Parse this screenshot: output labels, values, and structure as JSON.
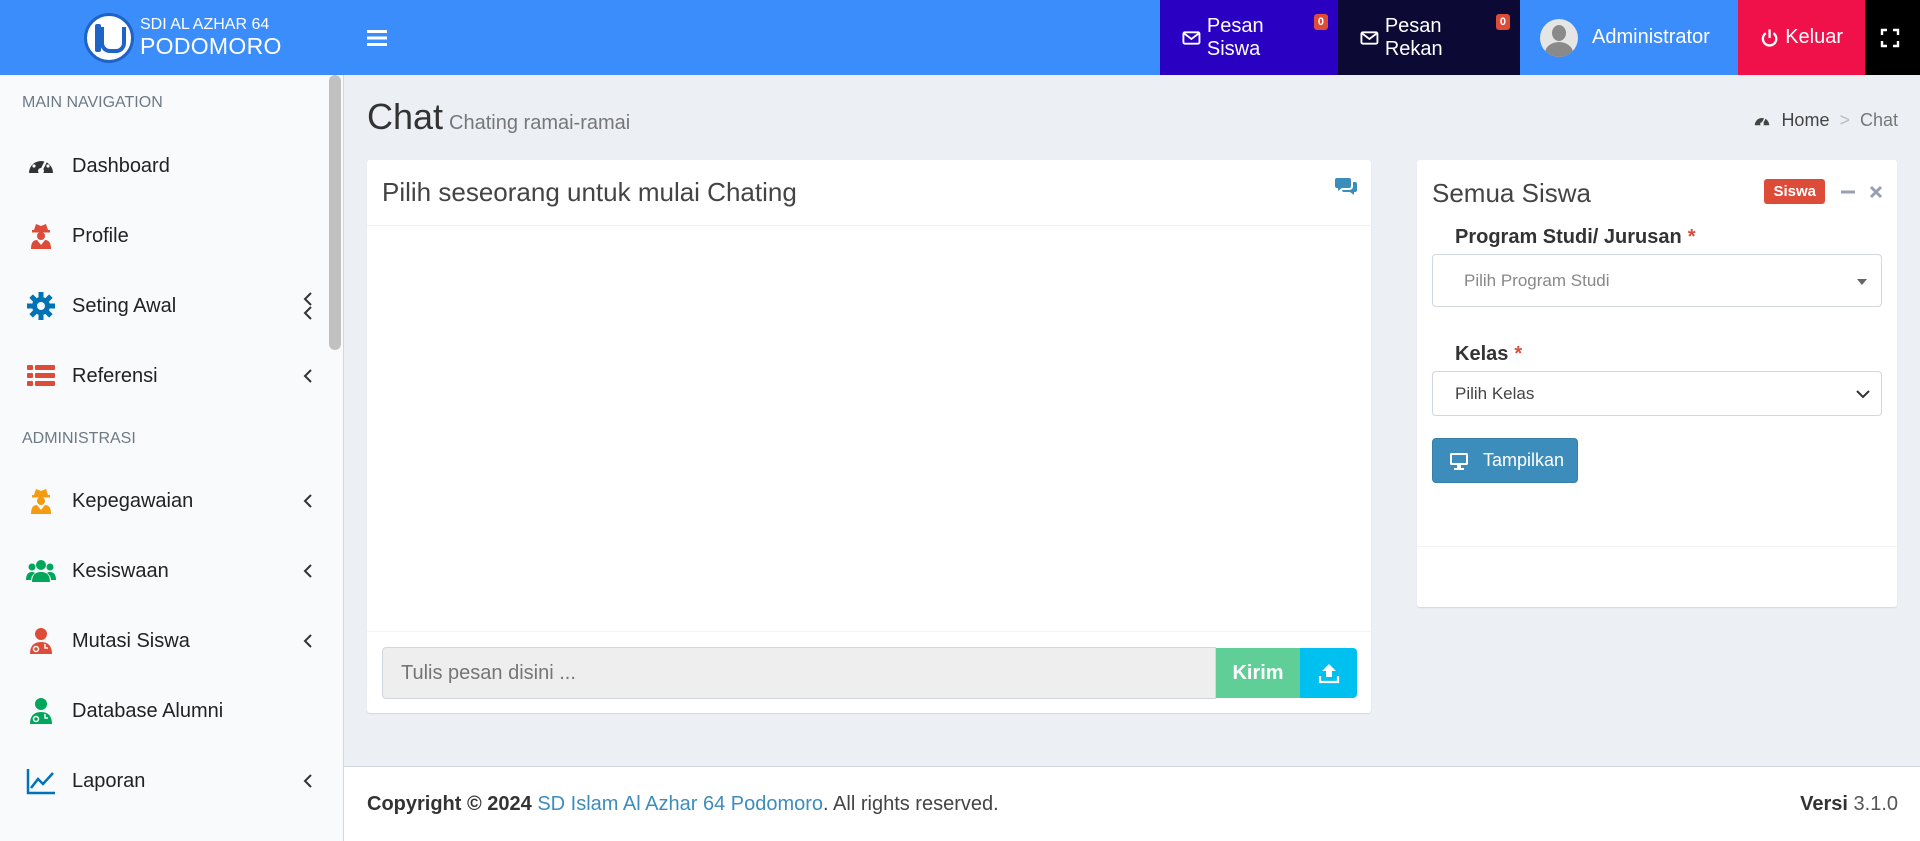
{
  "header": {
    "logo_small": "SDI AL AZHAR 64",
    "logo_big": "PODOMORO",
    "pesan_siswa": "Pesan Siswa",
    "pesan_siswa_count": "0",
    "pesan_rekan": "Pesan Rekan",
    "pesan_rekan_count": "0",
    "user_name": "Administrator",
    "logout": "Keluar"
  },
  "sidebar": {
    "header_main": "MAIN NAVIGATION",
    "header_admin": "ADMINISTRASI",
    "items": [
      {
        "label": "Dashboard",
        "icon": "dashboard-icon",
        "color": "#333333"
      },
      {
        "label": "Profile",
        "icon": "user-secret-icon",
        "color": "#dd4b39"
      },
      {
        "label": "Seting Awal",
        "icon": "gear-icon",
        "color": "#0073b7"
      },
      {
        "label": "Referensi",
        "icon": "list-icon",
        "color": "#dd4b39"
      },
      {
        "label": "Kepegawaian",
        "icon": "user-secret-icon",
        "color": "#f39c12"
      },
      {
        "label": "Kesiswaan",
        "icon": "users-icon",
        "color": "#00a65a"
      },
      {
        "label": "Mutasi Siswa",
        "icon": "user-md-icon",
        "color": "#dd4b39"
      },
      {
        "label": "Database Alumni",
        "icon": "user-md-icon",
        "color": "#00a65a"
      },
      {
        "label": "Laporan",
        "icon": "line-chart-icon",
        "color": "#0073b7"
      }
    ]
  },
  "page": {
    "title": "Chat",
    "subtitle": "Chating ramai-ramai",
    "breadcrumb_home": "Home",
    "breadcrumb_current": "Chat"
  },
  "chat": {
    "title": "Pilih seseorang untuk mulai Chating",
    "input_placeholder": "Tulis pesan disini ...",
    "send_label": "Kirim"
  },
  "siswa_panel": {
    "title": "Semua Siswa",
    "badge": "Siswa",
    "program_label": "Program Studi/ Jurusan",
    "program_placeholder": "Pilih Program Studi",
    "kelas_label": "Kelas",
    "kelas_value": "Pilih Kelas",
    "show_button": "Tampilkan",
    "required_mark": "*"
  },
  "footer": {
    "copyright": "Copyright © 2024",
    "school_link": "SD Islam Al Azhar 64 Podomoro",
    "rights": ". All rights reserved.",
    "version_label": "Versi",
    "version": "3.1.0"
  },
  "colors": {
    "header_bg": "#3c8dfc",
    "pesan_siswa_bg": "#2a00c2",
    "pesan_rekan_bg": "#0c0a35",
    "keluar_bg": "#f0104a",
    "kirim_bg": "#5fce97",
    "upload_bg": "#00c0ef",
    "primary_btn": "#3c8dbc"
  }
}
